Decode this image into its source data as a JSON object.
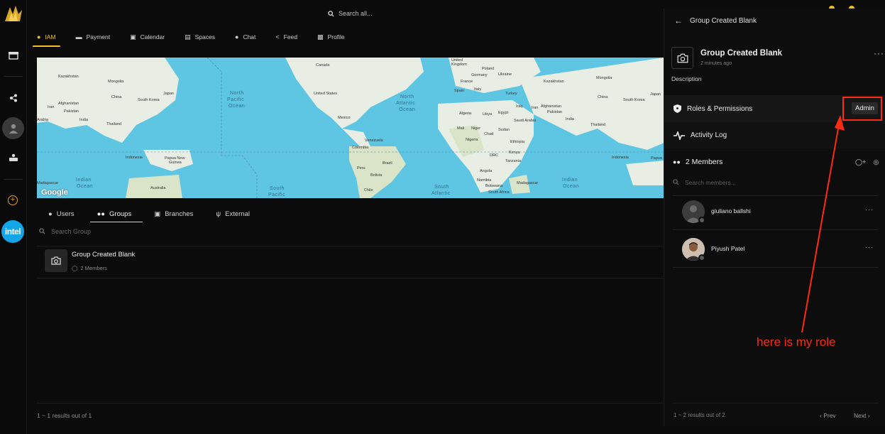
{
  "topbar": {
    "search_placeholder": "Search all..."
  },
  "nav": {
    "tabs": [
      {
        "label": "IAM",
        "icon": "user-icon",
        "active": true
      },
      {
        "label": "Payment",
        "icon": "card-icon"
      },
      {
        "label": "Calendar",
        "icon": "calendar-icon"
      },
      {
        "label": "Spaces",
        "icon": "spaces-icon"
      },
      {
        "label": "Chat",
        "icon": "chat-icon"
      },
      {
        "label": "Feed",
        "icon": "share-icon"
      },
      {
        "label": "Profile",
        "icon": "id-card-icon"
      }
    ]
  },
  "rail": {
    "org_label": "intel"
  },
  "map": {
    "brand": "Google",
    "labels": [
      "Kazakhstan",
      "Mongolia",
      "China",
      "Japan",
      "South Korea",
      "Afghanistan",
      "Pakistan",
      "Iran",
      "India",
      "Thailand",
      "Arabia",
      "Indonesia",
      "Papua New Guinea",
      "Australia",
      "Madagascar",
      "Canada",
      "United States",
      "Mexico",
      "Venezuela",
      "Colombia",
      "Peru",
      "Brazil",
      "Bolivia",
      "Chile",
      "United Kingdom",
      "Poland",
      "Germany",
      "Ukraine",
      "France",
      "Spain",
      "Italy",
      "Turkey",
      "Algeria",
      "Libya",
      "Egypt",
      "Mali",
      "Niger",
      "Chad",
      "Sudan",
      "Nigeria",
      "Ethiopia",
      "DRC",
      "Kenya",
      "Tanzania",
      "Angola",
      "Namibia",
      "Botswana",
      "South Africa",
      "Saudi Arabia",
      "Iraq",
      "Iran",
      "Mongolia",
      "China",
      "South Korea",
      "Japan",
      "Thailand",
      "Indonesia",
      "Papua New Guinea"
    ],
    "oceans": [
      "North Pacific Ocean",
      "North Atlantic Ocean",
      "Indian Ocean",
      "South Pacific Ocean",
      "South Atlantic Ocean",
      "Indian Ocean"
    ]
  },
  "subtabs": [
    {
      "label": "Users",
      "icon": "user-icon"
    },
    {
      "label": "Groups",
      "icon": "users-icon",
      "active": true
    },
    {
      "label": "Branches",
      "icon": "building-icon"
    },
    {
      "label": "External",
      "icon": "branch-icon"
    }
  ],
  "groups": {
    "search_placeholder": "Search Group",
    "items": [
      {
        "name": "Group Created Blank",
        "members": "2 Members"
      }
    ],
    "results": "1 ~ 1 results out of 1"
  },
  "panel": {
    "header_title": "Group Created Blank",
    "group_title": "Group Created Blank",
    "created": "2 minutes ago",
    "description_label": "Description",
    "roles_label": "Roles & Permissions",
    "role_value": "Admin",
    "activity_label": "Activity Log",
    "members_label": "2 Members",
    "members_search_placeholder": "Search members...",
    "members": [
      {
        "name": "giuliano ballshi"
      },
      {
        "name": "Piyush Patel"
      }
    ],
    "results": "1 ~ 2 results out of 2",
    "prev_label": "Prev",
    "next_label": "Next"
  },
  "annotation": {
    "text": "here is my role",
    "color": "#ff2a14"
  },
  "colors": {
    "accent": "#f0c020",
    "intel": "#12a6e8",
    "map_water": "#5ec6e3",
    "map_land": "#e9eee4"
  }
}
